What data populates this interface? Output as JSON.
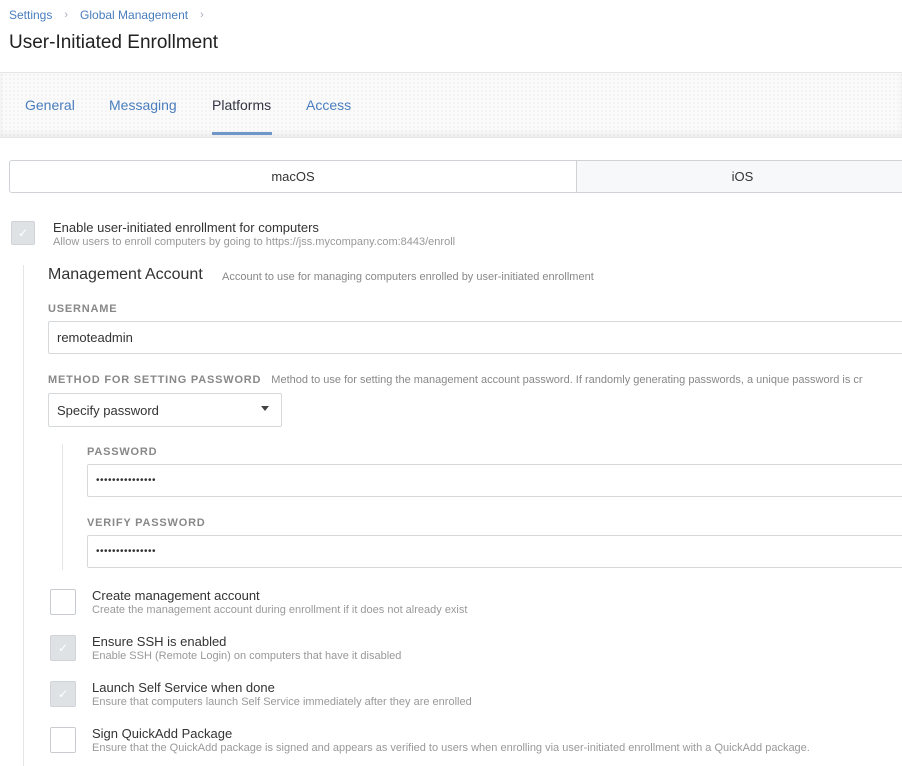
{
  "breadcrumb": [
    "Settings",
    "Global Management"
  ],
  "page_title": "User-Initiated Enrollment",
  "tabs": [
    {
      "label": "General",
      "active": false
    },
    {
      "label": "Messaging",
      "active": false
    },
    {
      "label": "Platforms",
      "active": true
    },
    {
      "label": "Access",
      "active": false
    }
  ],
  "platforms": {
    "macos": "macOS",
    "ios": "iOS",
    "selected": "macOS"
  },
  "enable": {
    "checked": true,
    "label": "Enable user-initiated enrollment for computers",
    "desc": "Allow users to enroll computers by going to https://jss.mycompany.com:8443/enroll"
  },
  "management_account": {
    "title": "Management Account",
    "desc": "Account to use for managing computers enrolled by user-initiated enrollment",
    "username_label": "USERNAME",
    "username_value": "remoteadmin",
    "method_label": "METHOD FOR SETTING PASSWORD",
    "method_desc": "Method to use for setting the management account password. If randomly generating passwords, a unique password is cr",
    "method_value": "Specify password",
    "password_label": "PASSWORD",
    "password_value": "•••••••••••••••",
    "verify_label": "VERIFY PASSWORD",
    "verify_value": "•••••••••••••••"
  },
  "options": [
    {
      "checked": false,
      "label": "Create management account",
      "desc": "Create the management account during enrollment if it does not already exist"
    },
    {
      "checked": true,
      "label": "Ensure SSH is enabled",
      "desc": "Enable SSH (Remote Login) on computers that have it disabled"
    },
    {
      "checked": true,
      "label": "Launch Self Service when done",
      "desc": "Ensure that computers launch Self Service immediately after they are enrolled"
    },
    {
      "checked": false,
      "label": "Sign QuickAdd Package",
      "desc": "Ensure that the QuickAdd package is signed and appears as verified to users when enrolling via user-initiated enrollment with a QuickAdd package."
    }
  ],
  "checkmark": "✓"
}
